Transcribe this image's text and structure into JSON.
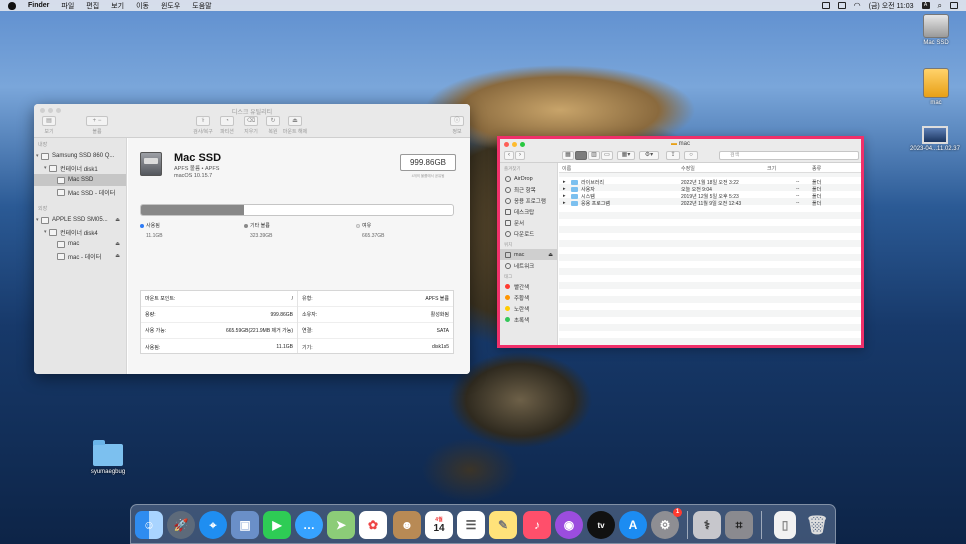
{
  "menubar": {
    "items": [
      "Finder",
      "파일",
      "편집",
      "보기",
      "이동",
      "윈도우",
      "도움말"
    ],
    "clock": "(금) 오전 11:03",
    "input_method": "A"
  },
  "desktop": {
    "icons": [
      {
        "label": "Mac SSD"
      },
      {
        "label": "mac"
      },
      {
        "label": "2023-04...11.02.37"
      },
      {
        "label": "syumaegbug"
      }
    ]
  },
  "disk_utility": {
    "title": "디스크 유틸리티",
    "toolbar": [
      "보기",
      "볼륨",
      "검사/복구",
      "파티션",
      "지우기",
      "복원",
      "마운트 해제",
      "정보"
    ],
    "sidebar": {
      "internal_header": "내장",
      "internal_items": [
        "Samsung SSD 860 Q...",
        "컨테이너 disk1",
        "Mac SSD",
        "Mac SSD - 데이터"
      ],
      "external_header": "외장",
      "external_items": [
        "APPLE SSD SM05...",
        "컨테이너 disk4",
        "mac",
        "mac - 데이터"
      ]
    },
    "volume": {
      "name": "Mac SSD",
      "type": "APFS 볼륨 • APFS",
      "os": "macOS 10.15.7",
      "capacity": "999.86GB",
      "capacity_note": "4개의 볼륨에서 공유됨"
    },
    "usage": {
      "used_fraction": 0.1,
      "used_label": "사용됨",
      "used_value": "11.1GB",
      "used_color": "#2e7bf6",
      "other_label": "기타 볼륨",
      "other_value": "323.39GB",
      "other_color": "#8a8a8a",
      "free_label": "여유",
      "free_value": "665.37GB",
      "free_color": "#e8e8e8"
    },
    "info_left": [
      {
        "k": "마운트 포인트:",
        "v": "/"
      },
      {
        "k": "용량:",
        "v": "999.86GB"
      },
      {
        "k": "사용 가능:",
        "v": "665.59GB(221.9MB 제거 가능)"
      },
      {
        "k": "사용됨:",
        "v": "11.1GB"
      }
    ],
    "info_right": [
      {
        "k": "유형:",
        "v": "APFS 볼륨"
      },
      {
        "k": "소유자:",
        "v": "활성화됨"
      },
      {
        "k": "연결:",
        "v": "SATA"
      },
      {
        "k": "기기:",
        "v": "disk1s5"
      }
    ]
  },
  "finder": {
    "title": "mac",
    "search_placeholder": "검색",
    "sidebar": {
      "favorites_header": "즐겨찾기",
      "favorites": [
        "AirDrop",
        "최근 항목",
        "응용 프로그램",
        "데스크탑",
        "문서",
        "다운로드"
      ],
      "locations_header": "위치",
      "locations": [
        "mac",
        "네트워크"
      ],
      "tags_header": "태그",
      "tags": [
        {
          "name": "빨간색",
          "color": "#ff3b30"
        },
        {
          "name": "주황색",
          "color": "#ff9500"
        },
        {
          "name": "노란색",
          "color": "#ffcc00"
        },
        {
          "name": "초록색",
          "color": "#34c759"
        }
      ]
    },
    "columns": [
      "이름",
      "수정일",
      "크기",
      "종류"
    ],
    "rows": [
      {
        "name": "라이브러리",
        "date": "2022년 1월 18일 오전 3:22",
        "size": "--",
        "kind": "폴더"
      },
      {
        "name": "사용자",
        "date": "오늘 오전 9:04",
        "size": "--",
        "kind": "폴더"
      },
      {
        "name": "시스템",
        "date": "2019년 12월 5일 오후 5:23",
        "size": "--",
        "kind": "폴더"
      },
      {
        "name": "응용 프로그램",
        "date": "2022년 11월 9일 오전 12:43",
        "size": "--",
        "kind": "폴더"
      }
    ]
  },
  "dock": {
    "calendar_day": "14",
    "calendar_month": "4월",
    "settings_badge": "1",
    "apps": [
      "finder-icon",
      "launchpad-icon",
      "safari-icon",
      "preview-icon",
      "facetime-icon",
      "messages-icon",
      "maps-icon",
      "photos-icon",
      "contacts-icon",
      "calendar-icon",
      "reminders-icon",
      "notes-icon",
      "music-icon",
      "podcasts-icon",
      "tv-icon",
      "app-store-icon",
      "system-preferences-icon",
      "disk-utility-icon",
      "screenshot-icon",
      "document-icon",
      "trash-icon"
    ]
  }
}
